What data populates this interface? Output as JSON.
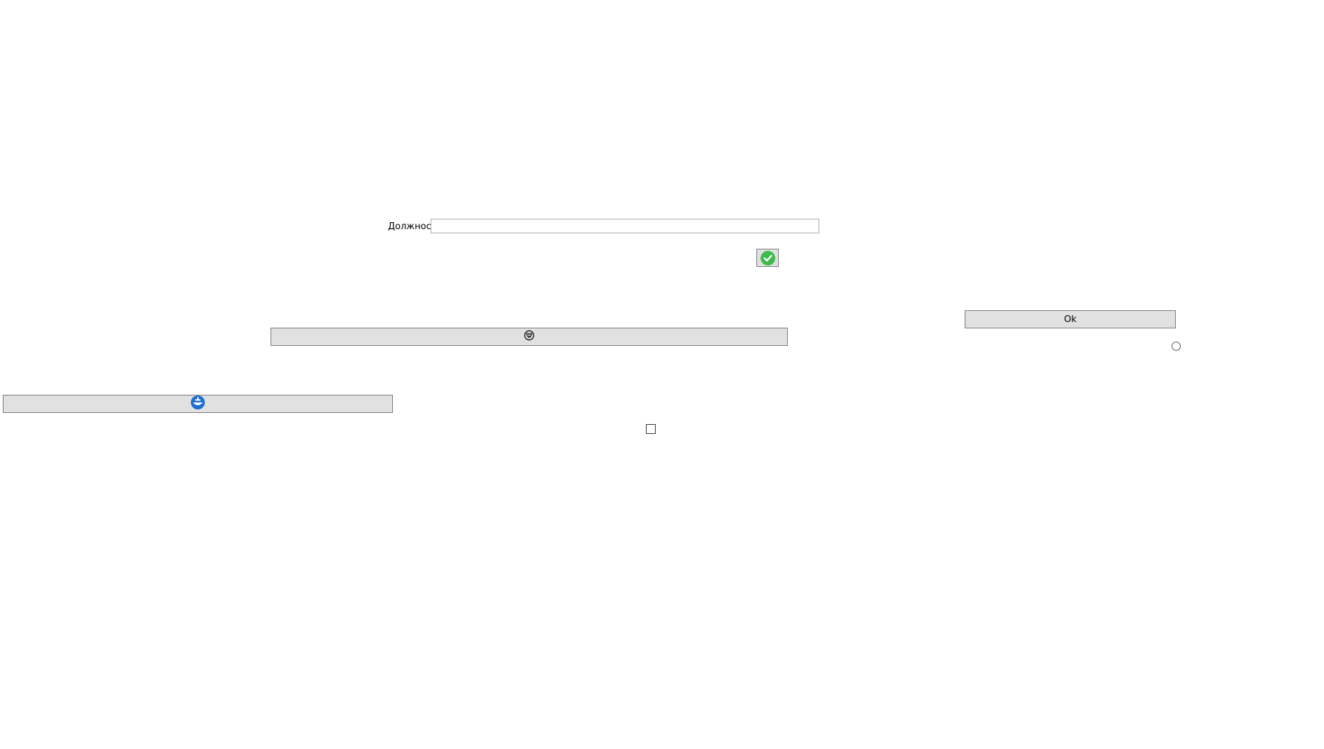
{
  "form": {
    "position_label": "Должность",
    "position_value": "",
    "position_placeholder": ""
  },
  "buttons": {
    "confirm_icon": "check-circle-icon",
    "ok_label": "Ok",
    "smiley_icon": "smiley-face-icon",
    "badge_icon": "blue-badge-icon"
  },
  "controls": {
    "radio_checked": false,
    "checkbox_checked": false
  },
  "colors": {
    "button_bg": "#e1e1e1",
    "check_green": "#3dbb4b",
    "badge_blue": "#1f6fd1"
  }
}
